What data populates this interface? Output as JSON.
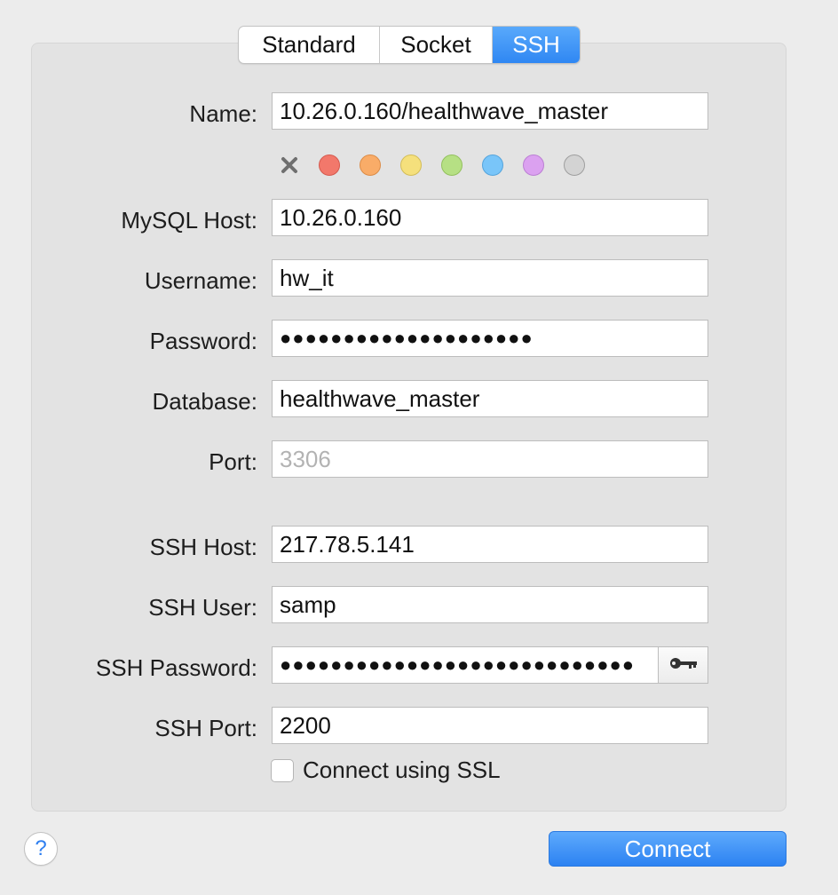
{
  "tabs": {
    "standard": "Standard",
    "socket": "Socket",
    "ssh": "SSH",
    "active": "SSH"
  },
  "form": {
    "name": {
      "label": "Name:",
      "value": "10.26.0.160/healthwave_master"
    },
    "mysql_host": {
      "label": "MySQL Host:",
      "value": "10.26.0.160"
    },
    "username": {
      "label": "Username:",
      "value": "hw_it"
    },
    "password": {
      "label": "Password:",
      "value": "●●●●●●●●●●●●●●●●●●●●"
    },
    "database": {
      "label": "Database:",
      "value": "healthwave_master"
    },
    "port": {
      "label": "Port:",
      "placeholder": "3306"
    },
    "ssh_host": {
      "label": "SSH Host:",
      "value": "217.78.5.141"
    },
    "ssh_user": {
      "label": "SSH User:",
      "value": "samp"
    },
    "ssh_password": {
      "label": "SSH Password:",
      "value": "●●●●●●●●●●●●●●●●●●●●●●●●●●●●"
    },
    "ssh_port": {
      "label": "SSH Port:",
      "value": "2200"
    },
    "ssl": {
      "label": "Connect using SSL",
      "checked": false
    }
  },
  "color_tags": [
    {
      "name": "none",
      "color": "#6f6f6f"
    },
    {
      "name": "red",
      "color": "#f2786b"
    },
    {
      "name": "orange",
      "color": "#f9ac68"
    },
    {
      "name": "yellow",
      "color": "#f5e07c"
    },
    {
      "name": "green",
      "color": "#b6e084"
    },
    {
      "name": "blue",
      "color": "#79c5f9"
    },
    {
      "name": "purple",
      "color": "#dba1f0"
    },
    {
      "name": "gray",
      "color": "#d3d3d3"
    }
  ],
  "icons": {
    "key": "key-icon",
    "help": "help-icon",
    "clear": "close-icon"
  },
  "help_label": "?",
  "connect_label": "Connect",
  "accent_color": "#2f87f3"
}
